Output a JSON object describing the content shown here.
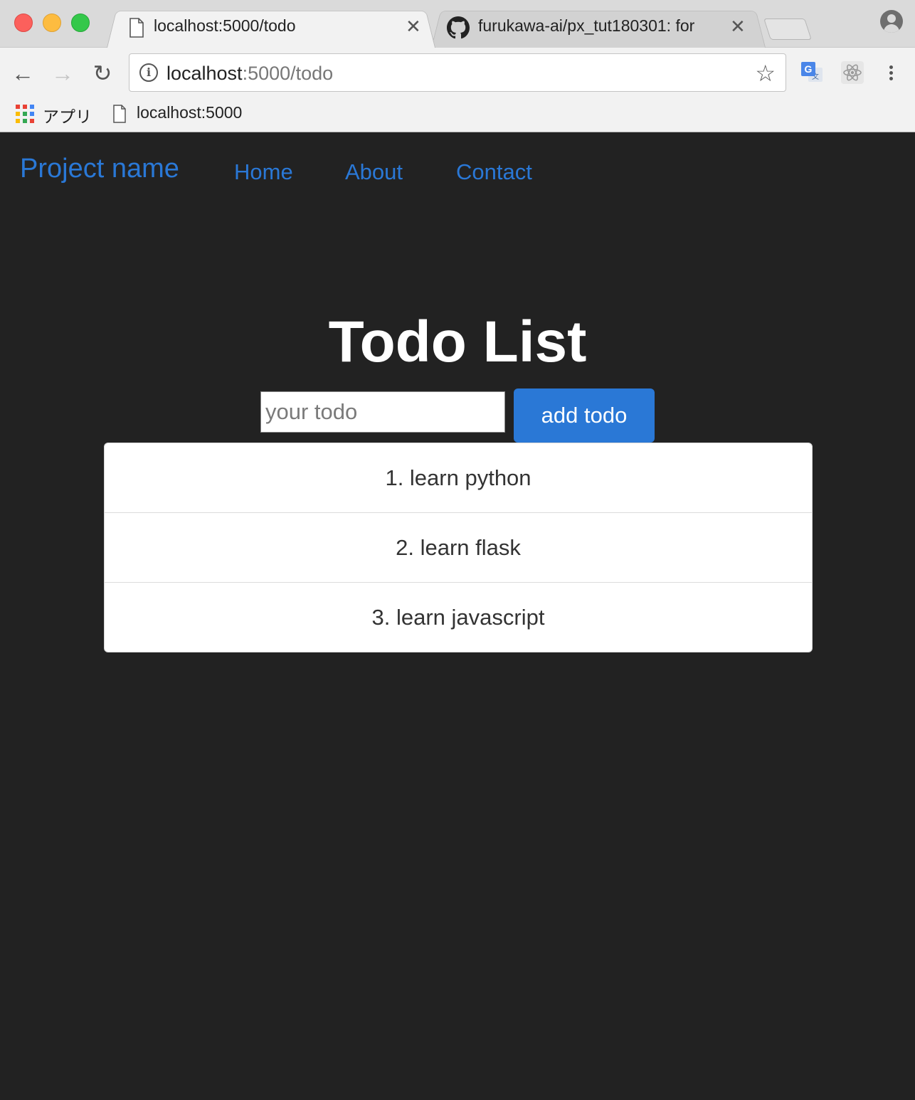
{
  "browser": {
    "tabs": [
      {
        "title": "localhost:5000/todo",
        "active": true,
        "icon": "page-icon"
      },
      {
        "title": "furukawa-ai/px_tut180301: for",
        "active": false,
        "icon": "github-icon"
      }
    ],
    "address": {
      "host": "localhost",
      "rest": ":5000/todo"
    },
    "bookmarks": [
      {
        "label": "アプリ",
        "icon": "apps-grid-icon"
      },
      {
        "label": "localhost:5000",
        "icon": "page-icon"
      }
    ]
  },
  "navbar": {
    "brand": "Project name",
    "links": [
      "Home",
      "About",
      "Contact"
    ]
  },
  "main": {
    "title": "Todo List",
    "input": {
      "value": "",
      "placeholder": "your todo"
    },
    "add_button": "add todo",
    "todos": [
      "1. learn python",
      "2. learn flask",
      "3. learn javascript"
    ]
  },
  "colors": {
    "page_background": "#222222",
    "accent": "#2a78d6",
    "text_light": "#ffffff"
  }
}
